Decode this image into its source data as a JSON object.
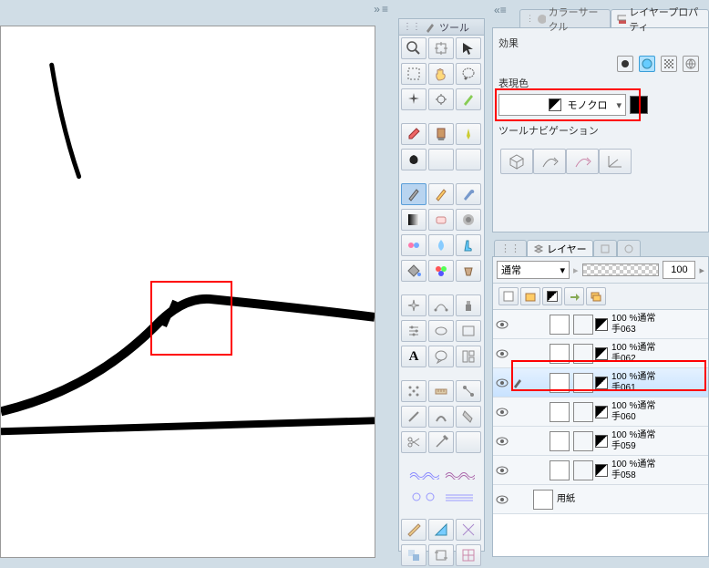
{
  "toolbar_label": "ツール",
  "tabs": {
    "color_circle": "カラーサークル",
    "layer_props": "レイヤープロパティ"
  },
  "props": {
    "effect_label": "効果",
    "color_label": "表現色",
    "color_mode": "モノクロ",
    "toolnav_label": "ツールナビゲーション"
  },
  "layer_tab": "レイヤー",
  "blend_mode": "通常",
  "opacity": "100",
  "layers": [
    {
      "op": "100 %通常",
      "name": "手063"
    },
    {
      "op": "100 %通常",
      "name": "手062"
    },
    {
      "op": "100 %通常",
      "name": "手061",
      "selected": true
    },
    {
      "op": "100 %通常",
      "name": "手060"
    },
    {
      "op": "100 %通常",
      "name": "手059"
    },
    {
      "op": "100 %通常",
      "name": "手058"
    },
    {
      "op": "",
      "name": "用紙",
      "paper": true
    }
  ]
}
